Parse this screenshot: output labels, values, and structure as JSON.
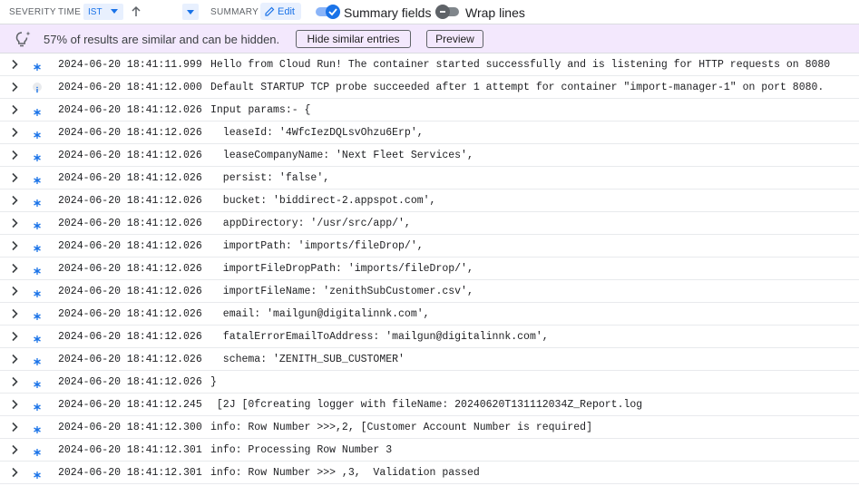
{
  "header": {
    "severity_label": "SEVERITY",
    "time_label": "TIME",
    "timezone": "IST",
    "summary_label": "SUMMARY",
    "edit_label": "Edit",
    "summary_fields_label": "Summary fields",
    "summary_fields_on": true,
    "wrap_lines_label": "Wrap lines",
    "wrap_lines_on": false
  },
  "banner": {
    "text": "57% of results are similar and can be hidden.",
    "hide_button": "Hide similar entries",
    "preview_button": "Preview"
  },
  "colors": {
    "accent": "#1a73e8",
    "banner_bg": "#f3e8fd"
  },
  "rows": [
    {
      "severity": "debug",
      "time": "2024-06-20 18:41:11.999",
      "message": "Hello from Cloud Run! The container started successfully and is listening for HTTP requests on 8080"
    },
    {
      "severity": "info",
      "time": "2024-06-20 18:41:12.000",
      "message": "Default STARTUP TCP probe succeeded after 1 attempt for container \"import-manager-1\" on port 8080."
    },
    {
      "severity": "debug",
      "time": "2024-06-20 18:41:12.026",
      "message": "Input params:- {"
    },
    {
      "severity": "debug",
      "time": "2024-06-20 18:41:12.026",
      "message": "  leaseId: '4WfcIezDQLsvOhzu6Erp',"
    },
    {
      "severity": "debug",
      "time": "2024-06-20 18:41:12.026",
      "message": "  leaseCompanyName: 'Next Fleet Services',"
    },
    {
      "severity": "debug",
      "time": "2024-06-20 18:41:12.026",
      "message": "  persist: 'false',"
    },
    {
      "severity": "debug",
      "time": "2024-06-20 18:41:12.026",
      "message": "  bucket: 'biddirect-2.appspot.com',"
    },
    {
      "severity": "debug",
      "time": "2024-06-20 18:41:12.026",
      "message": "  appDirectory: '/usr/src/app/',"
    },
    {
      "severity": "debug",
      "time": "2024-06-20 18:41:12.026",
      "message": "  importPath: 'imports/fileDrop/',"
    },
    {
      "severity": "debug",
      "time": "2024-06-20 18:41:12.026",
      "message": "  importFileDropPath: 'imports/fileDrop/',"
    },
    {
      "severity": "debug",
      "time": "2024-06-20 18:41:12.026",
      "message": "  importFileName: 'zenithSubCustomer.csv',"
    },
    {
      "severity": "debug",
      "time": "2024-06-20 18:41:12.026",
      "message": "  email: 'mailgun@digitalinnk.com',"
    },
    {
      "severity": "debug",
      "time": "2024-06-20 18:41:12.026",
      "message": "  fatalErrorEmailToAddress: 'mailgun@digitalinnk.com',"
    },
    {
      "severity": "debug",
      "time": "2024-06-20 18:41:12.026",
      "message": "  schema: 'ZENITH_SUB_CUSTOMER'"
    },
    {
      "severity": "debug",
      "time": "2024-06-20 18:41:12.026",
      "message": "}"
    },
    {
      "severity": "debug",
      "time": "2024-06-20 18:41:12.245",
      "message": " [2J [0fcreating logger with fileName: 20240620T131112034Z_Report.log"
    },
    {
      "severity": "debug",
      "time": "2024-06-20 18:41:12.300",
      "message": "info: Row Number >>>,2, [Customer Account Number is required]"
    },
    {
      "severity": "debug",
      "time": "2024-06-20 18:41:12.301",
      "message": "info: Processing Row Number 3"
    },
    {
      "severity": "debug",
      "time": "2024-06-20 18:41:12.301",
      "message": "info: Row Number >>> ,3,  Validation passed"
    }
  ]
}
